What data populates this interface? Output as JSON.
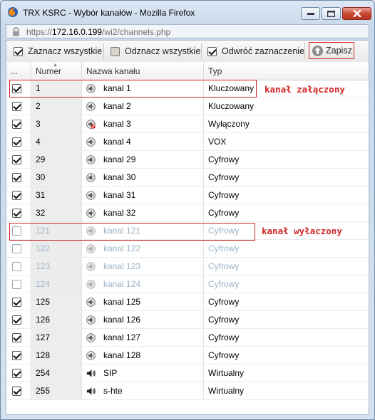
{
  "window": {
    "title": "TRX KSRC - Wybór kanałów - Mozilla Firefox",
    "url_prefix": "https://",
    "url_host": "172.16.0.199",
    "url_path": "/wi2/channels.php"
  },
  "toolbar": {
    "select_all": "Zaznacz wszystkie",
    "deselect_all": "Odznacz wszystkie",
    "invert": "Odwróć zaznaczenie",
    "save": "Zapisz"
  },
  "table": {
    "columns": [
      "...",
      "Numer",
      "Nazwa kanału",
      "Typ"
    ],
    "rows": [
      {
        "checked": true,
        "enabled": true,
        "number": "1",
        "name": "kanal 1",
        "icon": "speaker-icon",
        "type": "Kluczowany"
      },
      {
        "checked": true,
        "enabled": true,
        "number": "2",
        "name": "kanal 2",
        "icon": "speaker-icon",
        "type": "Kluczowany"
      },
      {
        "checked": true,
        "enabled": true,
        "number": "3",
        "name": "kanal 3",
        "icon": "speaker-muted-icon",
        "type": "Wyłączony"
      },
      {
        "checked": true,
        "enabled": true,
        "number": "4",
        "name": "kanal 4",
        "icon": "speaker-icon",
        "type": "VOX"
      },
      {
        "checked": true,
        "enabled": true,
        "number": "29",
        "name": "kanal 29",
        "icon": "speaker-icon",
        "type": "Cyfrowy"
      },
      {
        "checked": true,
        "enabled": true,
        "number": "30",
        "name": "kanal 30",
        "icon": "speaker-icon",
        "type": "Cyfrowy"
      },
      {
        "checked": true,
        "enabled": true,
        "number": "31",
        "name": "kanal 31",
        "icon": "speaker-icon",
        "type": "Cyfrowy"
      },
      {
        "checked": true,
        "enabled": true,
        "number": "32",
        "name": "kanal 32",
        "icon": "speaker-icon",
        "type": "Cyfrowy"
      },
      {
        "checked": false,
        "enabled": false,
        "number": "121",
        "name": "kanal 121",
        "icon": "speaker-icon",
        "type": "Cyfrowy"
      },
      {
        "checked": false,
        "enabled": false,
        "number": "122",
        "name": "kanal 122",
        "icon": "speaker-icon",
        "type": "Cyfrowy"
      },
      {
        "checked": false,
        "enabled": false,
        "number": "123",
        "name": "kanal 123",
        "icon": "speaker-icon",
        "type": "Cyfrowy"
      },
      {
        "checked": false,
        "enabled": false,
        "number": "124",
        "name": "kanal 124",
        "icon": "speaker-icon",
        "type": "Cyfrowy"
      },
      {
        "checked": true,
        "enabled": true,
        "number": "125",
        "name": "kanal 125",
        "icon": "speaker-icon",
        "type": "Cyfrowy"
      },
      {
        "checked": true,
        "enabled": true,
        "number": "126",
        "name": "kanal 126",
        "icon": "speaker-icon",
        "type": "Cyfrowy"
      },
      {
        "checked": true,
        "enabled": true,
        "number": "127",
        "name": "kanal 127",
        "icon": "speaker-icon",
        "type": "Cyfrowy"
      },
      {
        "checked": true,
        "enabled": true,
        "number": "128",
        "name": "kanal 128",
        "icon": "speaker-icon",
        "type": "Cyfrowy"
      },
      {
        "checked": true,
        "enabled": true,
        "number": "254",
        "name": "SIP",
        "icon": "volume-icon",
        "type": "Wirtualny"
      },
      {
        "checked": true,
        "enabled": true,
        "number": "255",
        "name": "s-hte",
        "icon": "volume-icon",
        "type": "Wirtualny"
      }
    ]
  },
  "annotations": {
    "enabled_label": "kanał załączony",
    "disabled_label": "kanał wyłaczony"
  },
  "colors": {
    "annotation": "#d02828",
    "disabled_text": "#9db2c6"
  }
}
